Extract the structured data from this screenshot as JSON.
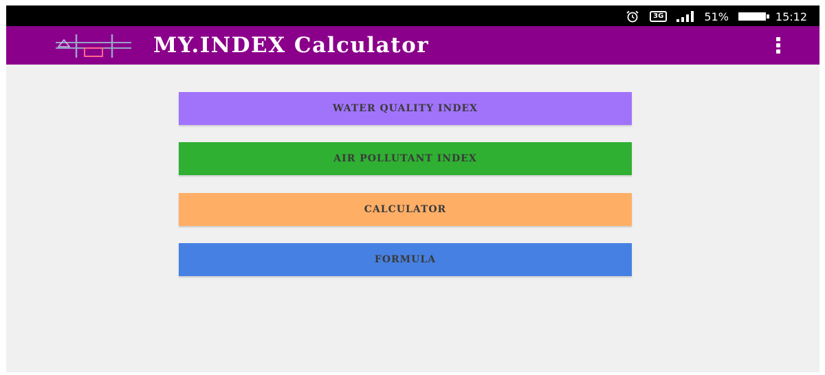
{
  "status_bar": {
    "alarm_icon": "alarm-clock-icon",
    "network_label": "3G",
    "signal_icon": "signal-strength-icon",
    "battery_percent": "51%",
    "battery_icon": "battery-icon",
    "time": "15:12"
  },
  "app_bar": {
    "title": "MY.INDEX Calculator",
    "logo_icon": "app-logo-icon",
    "menu_icon": "overflow-menu-icon",
    "color": "#8b008b"
  },
  "menu": {
    "buttons": [
      {
        "label": "WATER QUALITY INDEX",
        "color": "#a173fa"
      },
      {
        "label": "AIR POLLUTANT INDEX",
        "color": "#2fb032"
      },
      {
        "label": "CALCULATOR",
        "color": "#ffae66"
      },
      {
        "label": "FORMULA",
        "color": "#4680e2"
      }
    ]
  },
  "colors": {
    "content_background": "#f0f0f0",
    "button_text": "#3a3a3a"
  }
}
